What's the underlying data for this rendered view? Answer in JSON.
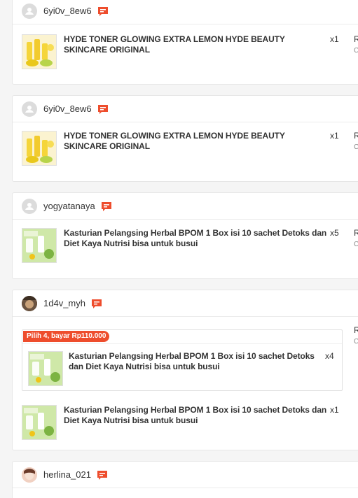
{
  "orders": [
    {
      "username": "6yi0v_8ew6",
      "items": [
        {
          "name": "HYDE TONER GLOWING EXTRA LEMON HYDE BEAUTY SKINCARE ORIGINAL",
          "qty": "x1",
          "thumb": "lemon-toner"
        }
      ],
      "right_top": "R",
      "right_sub": "C"
    },
    {
      "username": "6yi0v_8ew6",
      "items": [
        {
          "name": "HYDE TONER GLOWING EXTRA LEMON HYDE BEAUTY SKINCARE ORIGINAL",
          "qty": "x1",
          "thumb": "lemon-toner"
        }
      ],
      "right_top": "R",
      "right_sub": "C"
    },
    {
      "username": "yogyatanaya",
      "items": [
        {
          "name": "Kasturian Pelangsing Herbal BPOM 1 Box isi 10 sachet Detoks dan Diet Kaya Nutrisi bisa untuk busui",
          "qty": "x5",
          "thumb": "kasturian"
        }
      ],
      "right_top": "R",
      "right_sub": "C"
    },
    {
      "username": "1d4v_myh",
      "bundle": {
        "badge": "Pilih 4, bayar Rp110.000",
        "item": {
          "name": "Kasturian Pelangsing Herbal BPOM 1 Box isi 10 sachet Detoks dan Diet Kaya Nutrisi bisa untuk busui",
          "qty": "x4",
          "thumb": "kasturian"
        }
      },
      "items": [
        {
          "name": "Kasturian Pelangsing Herbal BPOM 1 Box isi 10 sachet Detoks dan Diet Kaya Nutrisi bisa untuk busui",
          "qty": "x1",
          "thumb": "kasturian"
        }
      ],
      "right_top": "R",
      "right_sub": "C"
    },
    {
      "username": "herlina_021"
    }
  ],
  "colors": {
    "accent": "#ee4d2d",
    "badge_bg": "#ee4d2d",
    "chat_icon": "#ee4d2d"
  },
  "icons": {
    "chat": "chat-bubble-icon",
    "user_placeholder": "user-placeholder-icon"
  }
}
